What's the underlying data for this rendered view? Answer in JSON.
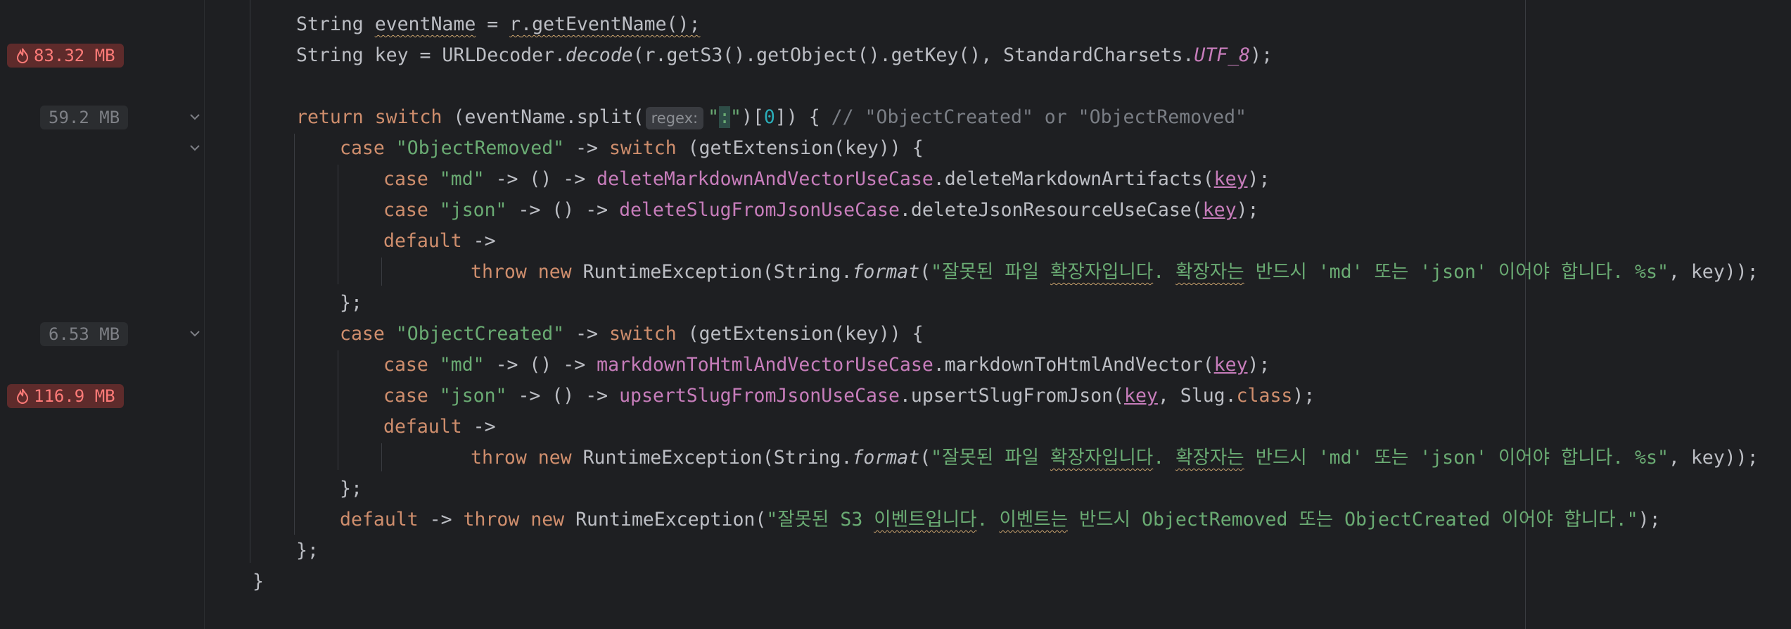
{
  "memory_badges": [
    {
      "label": "83.32 MB",
      "hot": true
    },
    {
      "label": "59.2 MB",
      "hot": false
    },
    {
      "label": "6.53 MB",
      "hot": false
    },
    {
      "label": "116.9 MB",
      "hot": true
    }
  ],
  "code": {
    "l1": {
      "a": "String ",
      "b": "eventName",
      "c": " = ",
      "d": "r",
      "e": ".getEventName();"
    },
    "l2": {
      "a": "String key = URLDecoder.",
      "b": "decode",
      "c": "(r.getS3().getObject().getKey(), StandardCharsets.",
      "d": "UTF_8",
      "e": ");"
    },
    "l4": {
      "a": "return ",
      "b": "switch",
      "c": " (eventName.split(",
      "hint": "regex:",
      "d": "\"",
      "e": ":",
      "f": "\"",
      "g": ")[",
      "h": "0",
      "i": "]) { ",
      "j": "// \"ObjectCreated\" or \"ObjectRemoved\""
    },
    "l5": {
      "a": "case ",
      "b": "\"ObjectRemoved\"",
      "c": " -> ",
      "d": "switch",
      "e": " (getExtension(key)) {"
    },
    "l6": {
      "a": "case ",
      "b": "\"md\"",
      "c": " -> () -> ",
      "d": "deleteMarkdownAndVectorUseCase",
      "e": ".deleteMarkdownArtifacts(",
      "f": "key",
      "g": ");"
    },
    "l7": {
      "a": "case ",
      "b": "\"json\"",
      "c": " -> () -> ",
      "d": "deleteSlugFromJsonUseCase",
      "e": ".deleteJsonResourceUseCase(",
      "f": "key",
      "g": ");"
    },
    "l8": {
      "a": "default",
      "b": " ->"
    },
    "l9": {
      "a": "throw ",
      "b": "new ",
      "c": "RuntimeException(String.",
      "d": "format",
      "e": "(",
      "f": "\"잘못된 파일 ",
      "g": "확장자입니다",
      "h": ". ",
      "i": "확장자는",
      "j": " 반드시 'md' 또는 'json' 이어야 합니다. %s\"",
      "k": ", key));"
    },
    "l10": {
      "a": "};"
    },
    "l11": {
      "a": "case ",
      "b": "\"ObjectCreated\"",
      "c": " -> ",
      "d": "switch",
      "e": " (getExtension(key)) {"
    },
    "l12": {
      "a": "case ",
      "b": "\"md\"",
      "c": " -> () -> ",
      "d": "markdownToHtmlAndVectorUseCase",
      "e": ".markdownToHtmlAndVector(",
      "f": "key",
      "g": ");"
    },
    "l13": {
      "a": "case ",
      "b": "\"json\"",
      "c": " -> () -> ",
      "d": "upsertSlugFromJsonUseCase",
      "e": ".upsertSlugFromJson(",
      "f": "key",
      "g": ", Slug.",
      "h": "class",
      "i": ");"
    },
    "l14": {
      "a": "default",
      "b": " ->"
    },
    "l15": {
      "a": "throw ",
      "b": "new ",
      "c": "RuntimeException(String.",
      "d": "format",
      "e": "(",
      "f": "\"잘못된 파일 ",
      "g": "확장자입니다",
      "h": ". ",
      "i": "확장자는",
      "j": " 반드시 'md' 또는 'json' 이어야 합니다. %s\"",
      "k": ", key));"
    },
    "l16": {
      "a": "};"
    },
    "l17": {
      "a": "default",
      "b": " -> ",
      "c": "throw ",
      "d": "new ",
      "e": "RuntimeException(",
      "f": "\"잘못된 S3 ",
      "g": "이벤트입니다",
      "h": ". ",
      "i": "이벤트는",
      "j": " 반드시 ObjectRemoved 또는 ObjectCreated 이어야 합니다.\"",
      "k": ");"
    },
    "l18": {
      "a": "};"
    },
    "l19": {
      "a": "}"
    }
  },
  "colors": {
    "background": "#1e1f22",
    "keyword": "#cf8e6d",
    "string": "#6aab73",
    "field": "#c77dbb",
    "comment": "#7a7e85",
    "number": "#2aacb8",
    "hot_badge": "#ff7b78"
  }
}
